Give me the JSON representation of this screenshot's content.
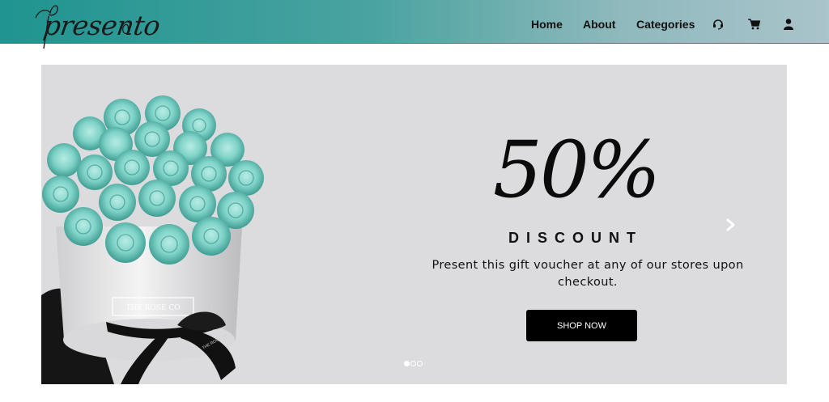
{
  "brand": {
    "logo_text": "presento"
  },
  "nav": {
    "links": [
      {
        "label": "Home"
      },
      {
        "label": "About"
      },
      {
        "label": "Categories"
      }
    ],
    "icons": [
      "support-headset-icon",
      "cart-icon",
      "user-icon"
    ]
  },
  "banner": {
    "headline": "50%",
    "subheadline": "DISCOUNT",
    "description": "Present this gift voucher at any of our stores upon checkout.",
    "cta_label": "SHOP NOW",
    "box_label": "THE ROSE CO",
    "ribbon_text": "THE ROSE CO",
    "slides_total": 3,
    "active_slide": 1
  },
  "colors": {
    "header_start": "#1f9490",
    "header_end": "#a9c4cb",
    "banner_bg": "#dcdcdf",
    "rose": "#7fd3c8",
    "cta_bg": "#000000"
  }
}
